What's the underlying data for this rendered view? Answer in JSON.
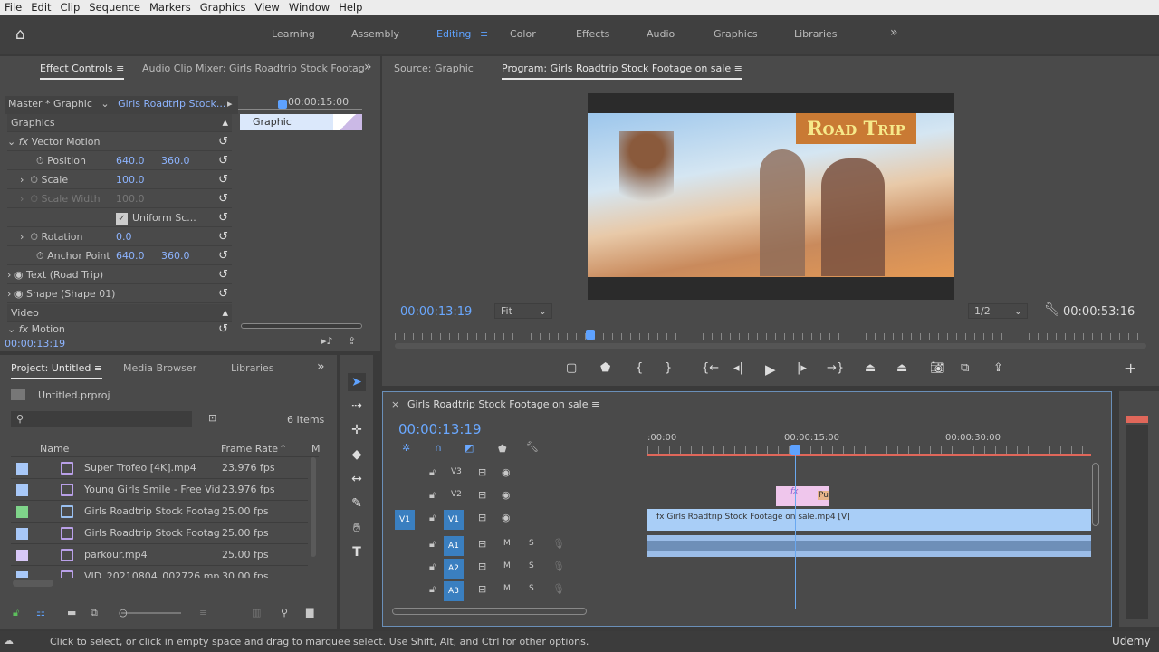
{
  "menu": [
    "File",
    "Edit",
    "Clip",
    "Sequence",
    "Markers",
    "Graphics",
    "View",
    "Window",
    "Help"
  ],
  "workspaces": [
    "Learning",
    "Assembly",
    "Editing",
    "Color",
    "Effects",
    "Audio",
    "Graphics",
    "Libraries"
  ],
  "active_workspace": "Editing",
  "effect_controls": {
    "tab": "Effect Controls",
    "tab2": "Audio Clip Mixer: Girls Roadtrip Stock Footag",
    "master": "Master * Graphic",
    "clip": "Girls Roadtrip Stock...",
    "timecode_ruler": "00:00:15:00",
    "graphic_clip": "Graphic",
    "section_graphics": "Graphics",
    "vector_motion": "Vector Motion",
    "position": {
      "label": "Position",
      "x": "640.0",
      "y": "360.0"
    },
    "scale": {
      "label": "Scale",
      "value": "100.0"
    },
    "scale_width": {
      "label": "Scale Width",
      "value": "100.0"
    },
    "uniform": {
      "label": "Uniform Sc...",
      "checked": true
    },
    "rotation": {
      "label": "Rotation",
      "value": "0.0"
    },
    "anchor": {
      "label": "Anchor Point",
      "x": "640.0",
      "y": "360.0"
    },
    "text_layer": "Text (Road Trip)",
    "shape_layer": "Shape (Shape 01)",
    "section_video": "Video",
    "motion": "Motion",
    "timecode": "00:00:13:19"
  },
  "monitor": {
    "source_tab": "Source: Graphic",
    "program_tab": "Program: Girls Roadtrip Stock Footage on sale",
    "title_overlay": "Road Trip",
    "timecode": "00:00:13:19",
    "fit": "Fit",
    "resolution": "1/2",
    "duration": "00:00:53:16",
    "playhead_fraction": 0.26
  },
  "project": {
    "tab": "Project: Untitled",
    "tab2": "Media Browser",
    "tab3": "Libraries",
    "file": "Untitled.prproj",
    "items_count": "6 Items",
    "col_name": "Name",
    "col_rate": "Frame Rate",
    "col_m": "M",
    "items": [
      {
        "name": "Super Trofeo [4K].mp4",
        "rate": "23.976 fps",
        "color": "#a8c8f8"
      },
      {
        "name": "Young Girls Smile - Free Vid",
        "rate": "23.976 fps",
        "color": "#a8c8f8"
      },
      {
        "name": "Girls Roadtrip Stock Footag",
        "rate": "25.00 fps",
        "color": "#7fd48a"
      },
      {
        "name": "Girls Roadtrip Stock Footag",
        "rate": "25.00 fps",
        "color": "#a8c8f8"
      },
      {
        "name": "parkour.mp4",
        "rate": "25.00 fps",
        "color": "#d8c8f8"
      },
      {
        "name": "VID_20210804_002726.mp",
        "rate": "30.00 fps",
        "color": "#a8c8f8"
      }
    ]
  },
  "timeline": {
    "title": "Girls Roadtrip Stock Footage on sale",
    "timecode": "00:00:13:19",
    "ruler": [
      ":00:00",
      "00:00:15:00",
      "00:00:30:00"
    ],
    "tracks": [
      "V3",
      "V2",
      "V1",
      "A1",
      "A2",
      "A3"
    ],
    "source_patch": "V1",
    "clip_v1": "Girls Roadtrip Stock Footage on sale.mp4 [V]",
    "clip_v2_label": "Pu",
    "mute": "M",
    "solo": "S"
  },
  "status": "Click to select, or click in empty space and drag to marquee select. Use Shift, Alt, and Ctrl for other options.",
  "brand": "Udemy"
}
